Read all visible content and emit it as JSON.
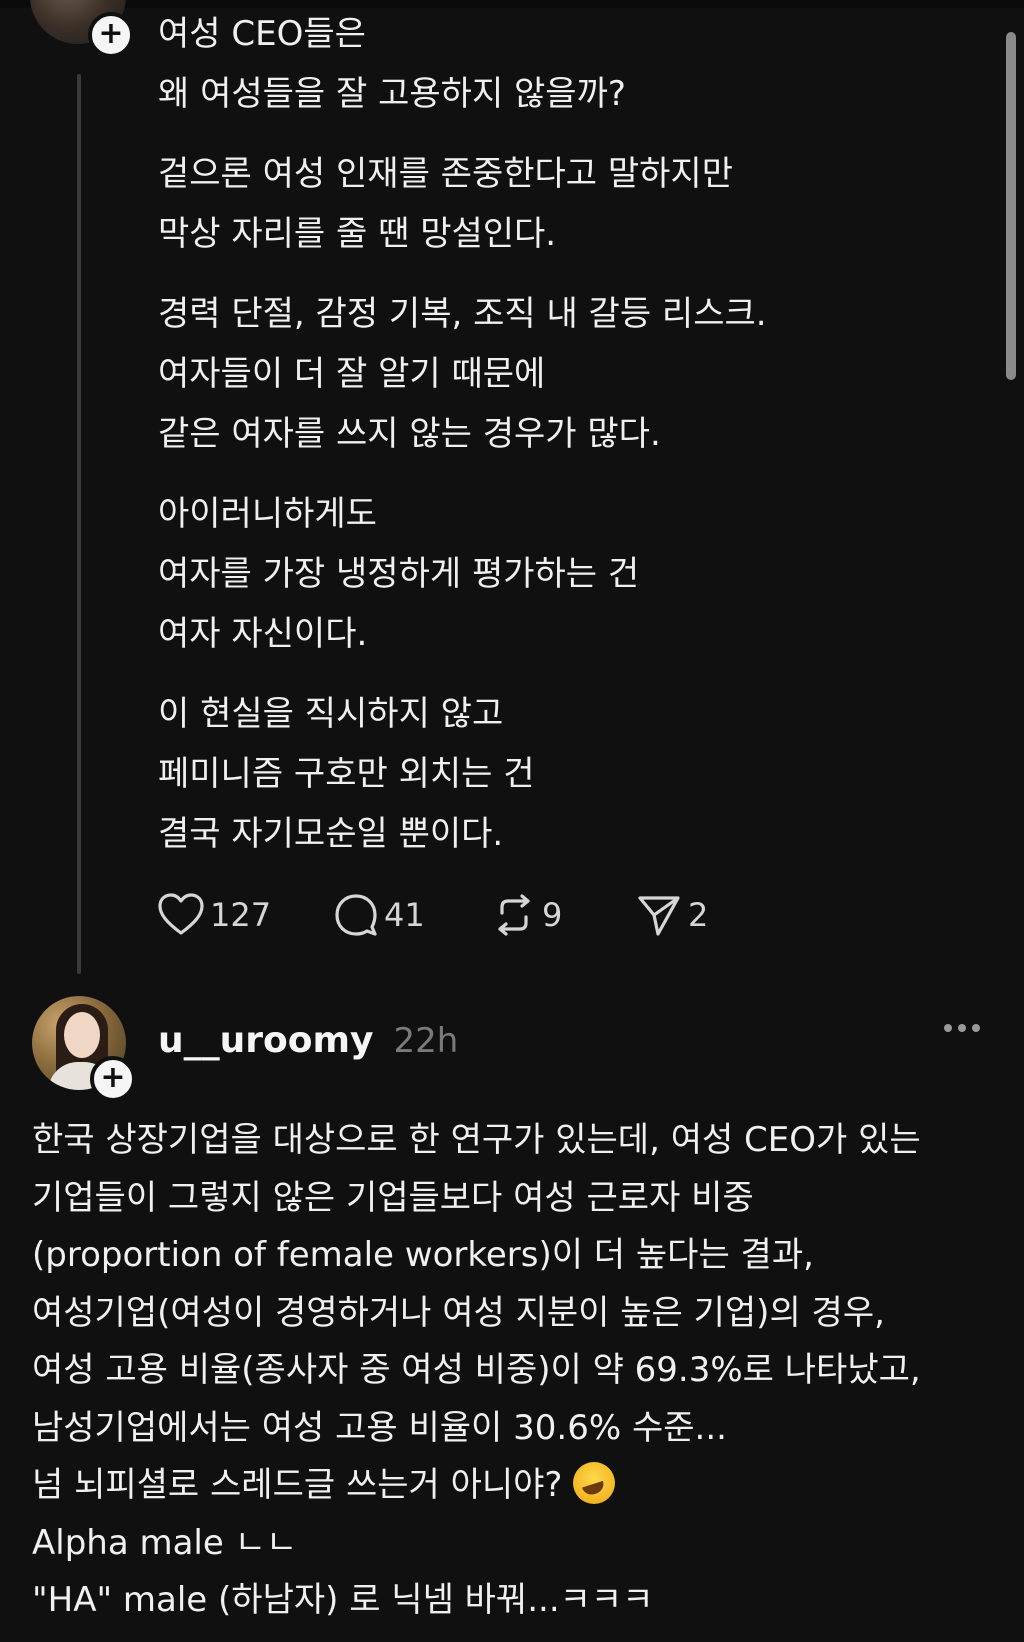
{
  "post1": {
    "paragraphs": [
      [
        "여성 CEO들은",
        "왜 여성들을 잘 고용하지 않을까?"
      ],
      [
        "겉으론 여성 인재를 존중한다고 말하지만",
        "막상 자리를 줄 땐 망설인다."
      ],
      [
        "경력 단절, 감정 기복, 조직 내 갈등 리스크.",
        "여자들이 더 잘 알기 때문에",
        "같은 여자를 쓰지 않는 경우가 많다."
      ],
      [
        "아이러니하게도",
        "여자를 가장 냉정하게 평가하는 건",
        "여자 자신이다."
      ],
      [
        "이 현실을 직시하지 않고",
        "페미니즘 구호만 외치는 건",
        "결국 자기모순일 뿐이다."
      ]
    ],
    "actions": {
      "like_count": "127",
      "comment_count": "41",
      "repost_count": "9",
      "share_count": "2"
    }
  },
  "post2": {
    "username": "u__uroomy",
    "time": "22h",
    "lines": [
      "한국 상장기업을 대상으로 한 연구가 있는데, 여성 CEO가 있는",
      "기업들이 그렇지 않은 기업들보다 여성 근로자 비중",
      "(proportion of female workers)이 더 높다는 결과,",
      "여성기업(여성이 경영하거나 여성 지분이 높은 기업)의 경우,",
      "여성 고용 비율(종사자 중 여성 비중)이 약 69.3%로 나타났고,",
      "남성기업에서는 여성 고용 비율이 30.6% 수준...",
      "넘 뇌피셜로 스레드글 쓰는거 아니야?",
      "Alpha male ㄴㄴ",
      "\"HA\" male (하남자) 로 닉넴 바꿔...ㅋㅋㅋ"
    ],
    "emoji_icon": "rolling-on-floor-laughing-emoji"
  },
  "icons": {
    "follow": "plus-icon",
    "like": "heart-icon",
    "comment": "comment-bubble-icon",
    "repost": "repost-icon",
    "share": "send-icon",
    "more": "more-icon"
  },
  "plus_glyph": "+"
}
